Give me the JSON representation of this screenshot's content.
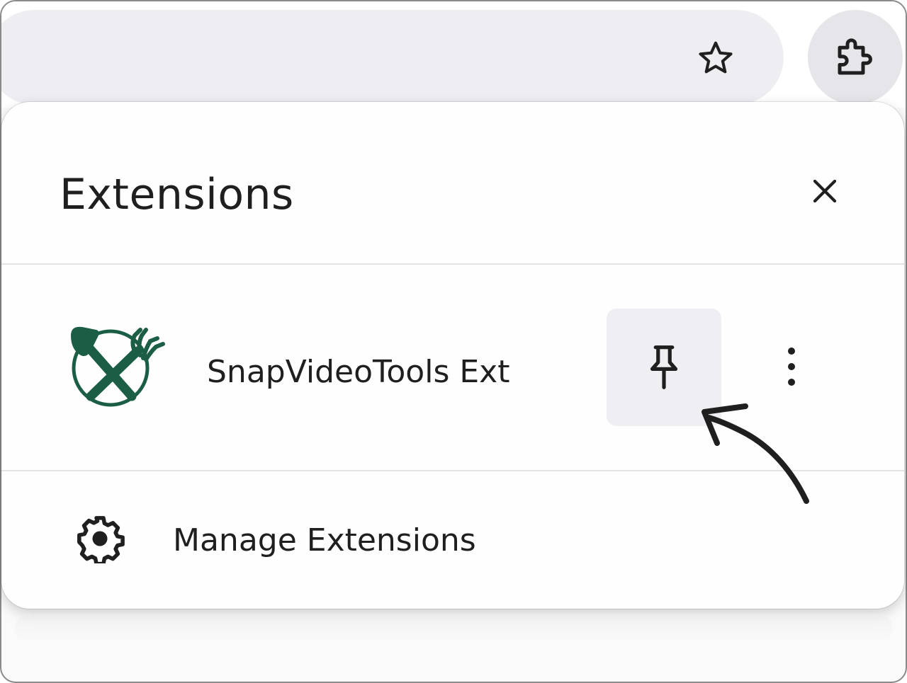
{
  "toolbar": {
    "bookmark_icon": "star-icon",
    "extensions_icon": "puzzle-icon"
  },
  "panel": {
    "title": "Extensions",
    "close_icon": "close-icon"
  },
  "extensions": [
    {
      "name": "SnapVideoTools Ext",
      "logo_color": "#1b5e45",
      "pin_icon": "pin-icon",
      "more_icon": "more-vert-icon"
    }
  ],
  "footer": {
    "manage_label": "Manage Extensions",
    "manage_icon": "gear-icon"
  },
  "annotation": {
    "arrow_icon": "hand-drawn-arrow-icon"
  }
}
